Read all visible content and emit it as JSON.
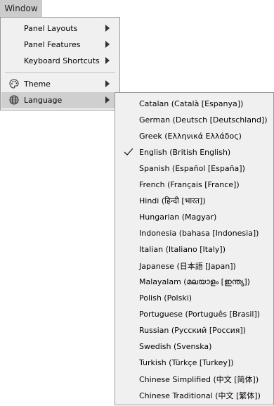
{
  "menubar": {
    "window_label": "Window"
  },
  "window_menu": {
    "items": [
      {
        "label": "Panel Layouts"
      },
      {
        "label": "Panel Features"
      },
      {
        "label": "Keyboard Shortcuts"
      },
      {
        "label": "Theme",
        "icon": "palette-icon"
      },
      {
        "label": "Language",
        "icon": "globe-icon"
      }
    ]
  },
  "language_menu": {
    "selected": "English (British English)",
    "items": [
      "Catalan (Català [Espanya])",
      "German (Deutsch [Deutschland])",
      "Greek (Ελληνικά Ελλάδος)",
      "English (British English)",
      "Spanish (Español [España])",
      "French (Français [France])",
      "Hindi (हिन्दी [भारत])",
      "Hungarian (Magyar)",
      "Indonesia (bahasa [Indonesia])",
      "Italian (Italiano [Italy])",
      "Japanese (日本語 [Japan])",
      "Malayalam (മലയാളം [ഇന്ത്യ])",
      "Polish (Polski)",
      "Portuguese (Português [Brasil])",
      "Russian (Русский [Россия])",
      "Swedish (Svenska)",
      "Turkish (Türkçe [Turkey])",
      "Chinese Simplified (中文 [简体])",
      "Chinese Traditional (中文 [繁体])"
    ]
  }
}
